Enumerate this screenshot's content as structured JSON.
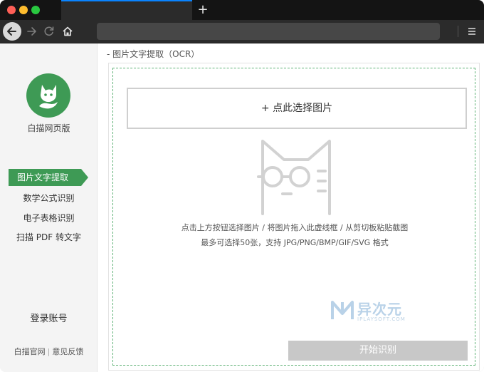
{
  "browser": {
    "new_tab_label": "+",
    "back_icon": "arrow-left-icon",
    "forward_icon": "arrow-right-icon",
    "reload_icon": "reload-icon",
    "home_icon": "home-icon",
    "menu_icon": "hamburger-menu-icon",
    "url_value": ""
  },
  "sidebar": {
    "brand": "白描网页版",
    "items": [
      {
        "label": "图片文字提取",
        "active": true
      },
      {
        "label": "数学公式识别"
      },
      {
        "label": "电子表格识别"
      },
      {
        "label": "扫描 PDF 转文字"
      }
    ],
    "login": "登录账号",
    "footer": {
      "official_site": "白描官网",
      "separator": "|",
      "feedback": "意见反馈"
    }
  },
  "main": {
    "breadcrumb": "- 图片文字提取（OCR）",
    "choose_button": "+ 点此选择图片",
    "hint_line1": "点击上方按钮选择图片 / 将图片拖入此虚线框 / 从剪切板粘贴截图",
    "hint_line2": "最多可选择50张，支持 JPG/PNG/BMP/GIF/SVG 格式",
    "start_button": "开始识别",
    "watermark": {
      "title": "异次元",
      "subtitle": "IPLAYSOFT.COM"
    }
  },
  "colors": {
    "brand_green": "#3e9a55",
    "dashed_border": "#5fb276",
    "disabled_button": "#c8c8c8"
  }
}
